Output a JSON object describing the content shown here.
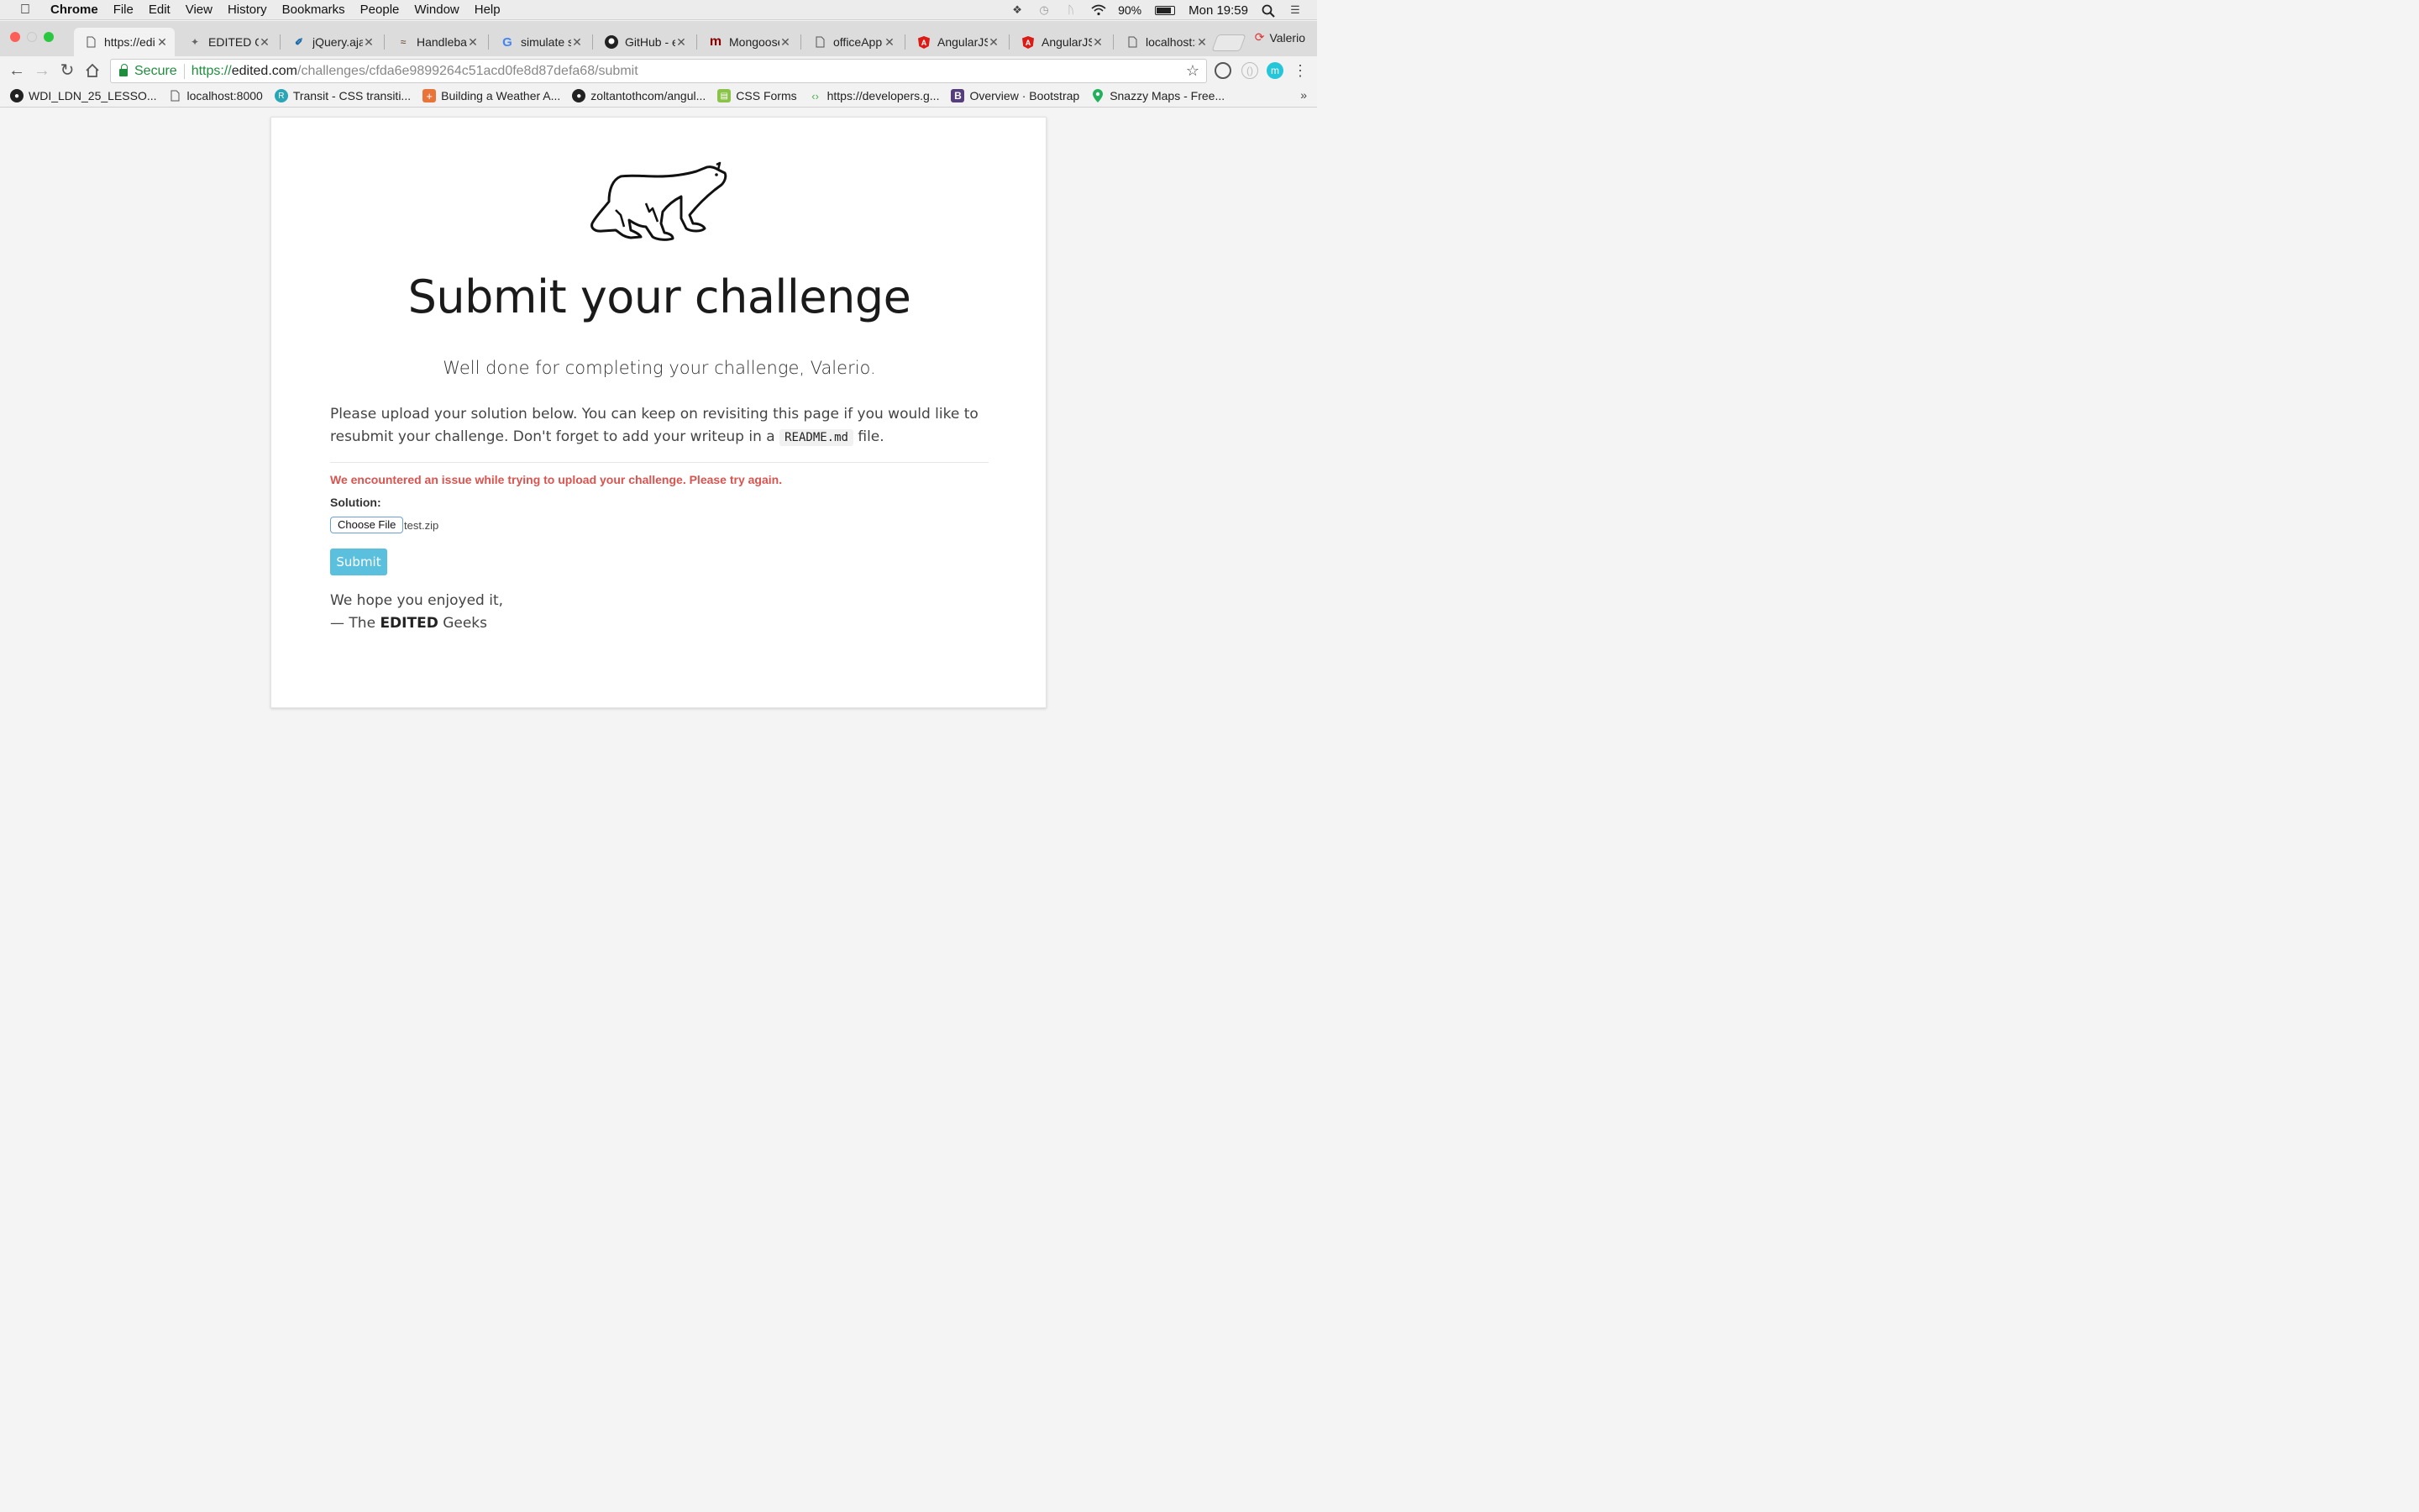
{
  "menubar": {
    "app": "Chrome",
    "items": [
      "File",
      "Edit",
      "View",
      "History",
      "Bookmarks",
      "People",
      "Window",
      "Help"
    ],
    "battery": "90%",
    "clock": "Mon 19:59"
  },
  "browser": {
    "tabs": [
      {
        "label": "https://edi",
        "icon": "page-icon",
        "active": true
      },
      {
        "label": "EDITED O",
        "icon": "bird-icon"
      },
      {
        "label": "jQuery.aja",
        "icon": "jquery-icon"
      },
      {
        "label": "Handlebar",
        "icon": "mustache-icon"
      },
      {
        "label": "simulate s",
        "icon": "google-icon"
      },
      {
        "label": "GitHub - e",
        "icon": "github-icon"
      },
      {
        "label": "Mongoose",
        "icon": "mongoose-icon"
      },
      {
        "label": "officeApp",
        "icon": "page-icon"
      },
      {
        "label": "AngularJS",
        "icon": "angular-icon"
      },
      {
        "label": "AngularJS",
        "icon": "angular-icon"
      },
      {
        "label": "localhost:3",
        "icon": "page-icon"
      }
    ],
    "profile": "Valerio",
    "secure_label": "Secure",
    "url": {
      "scheme": "https://",
      "host": "edited.com",
      "path": "/challenges/cfda6e9899264c51acd0fe8d87defa68/submit"
    },
    "bookmarks": [
      {
        "label": "WDI_LDN_25_LESSO...",
        "icon": "github-icon",
        "color": "#222222"
      },
      {
        "label": "localhost:8000",
        "icon": "page-icon",
        "color": "#ffffff"
      },
      {
        "label": "Transit - CSS transiti...",
        "icon": "transit-icon",
        "color": "#2aa5b6"
      },
      {
        "label": "Building a Weather A...",
        "icon": "plus-icon",
        "color": "#e9743a"
      },
      {
        "label": "zoltantothcom/angul...",
        "icon": "github-icon",
        "color": "#222222"
      },
      {
        "label": "CSS Forms",
        "icon": "forms-icon",
        "color": "#8bc34a"
      },
      {
        "label": "https://developers.g...",
        "icon": "google-dev-icon",
        "color": "#ffffff"
      },
      {
        "label": "Overview · Bootstrap",
        "icon": "bootstrap-icon",
        "color": "#563d7c"
      },
      {
        "label": "Snazzy Maps - Free...",
        "icon": "map-pin-icon",
        "color": "#20b15a"
      }
    ]
  },
  "page": {
    "title": "Submit your challenge",
    "lead": "Well done for completing your challenge, Valerio.",
    "instructions_1": "Please upload your solution below. You can keep on revisiting this page if you would like to resubmit your challenge. Don't forget to add your writeup in a",
    "instructions_code": "README.md",
    "instructions_2": "file.",
    "error": "We encountered an issue while trying to upload your challenge. Please try again.",
    "solution_label": "Solution:",
    "choose_file": "Choose File",
    "file_name": "test.zip",
    "submit": "Submit",
    "signoff_1": "We hope you enjoyed it,",
    "signoff_2_pre": "— The",
    "signoff_2_bold": "EDITED",
    "signoff_2_post": "Geeks"
  }
}
